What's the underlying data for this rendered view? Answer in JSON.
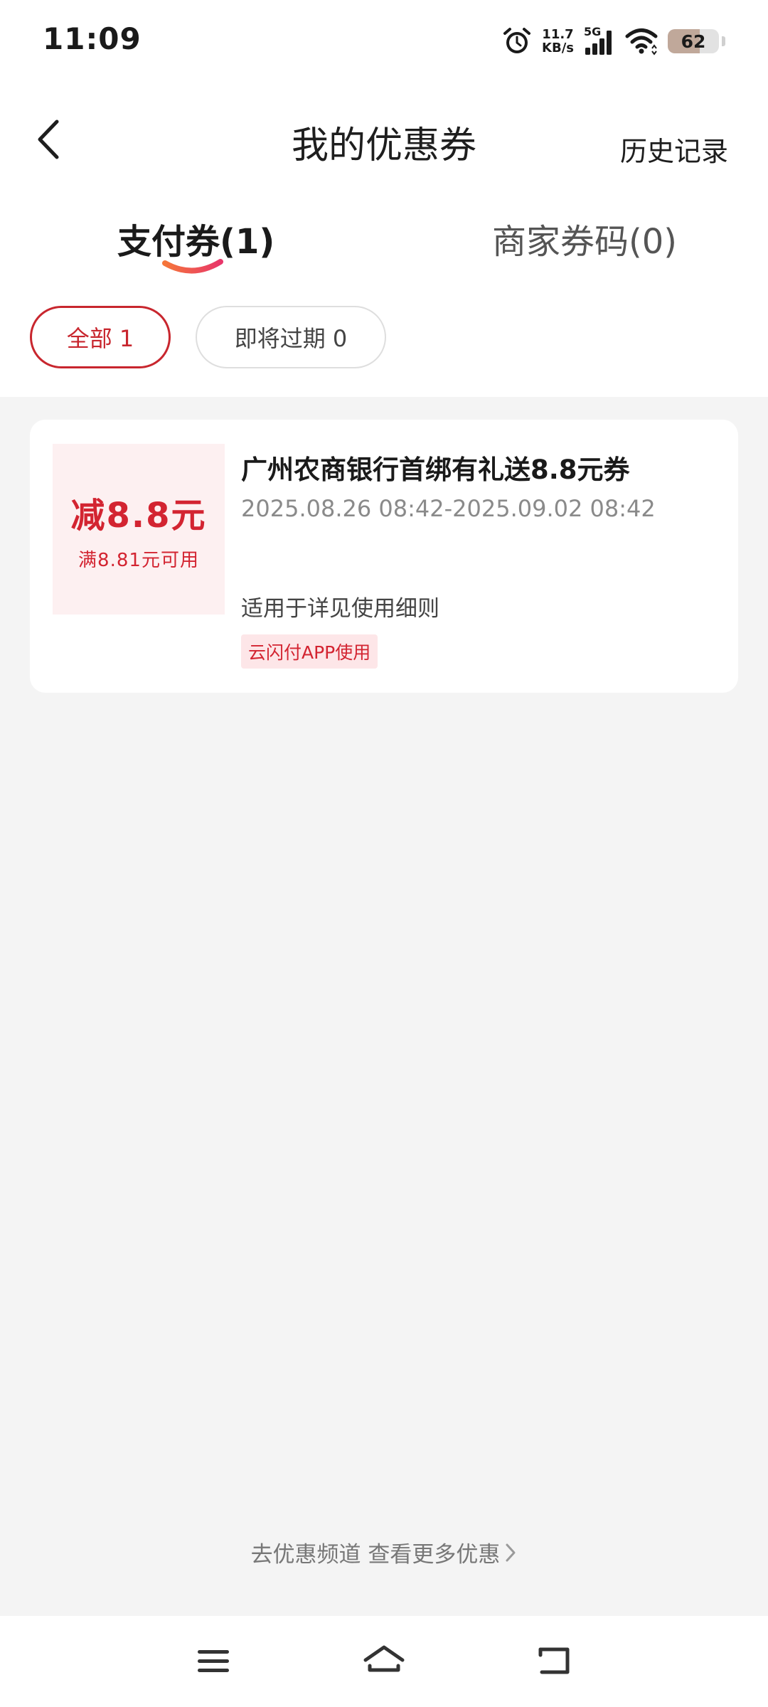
{
  "status_bar": {
    "time": "11:09",
    "net_speed_value": "11.7",
    "net_speed_unit": "KB/s",
    "network_type": "5G",
    "battery_level": "62",
    "battery_fraction": 0.62
  },
  "header": {
    "title": "我的优惠券",
    "history_label": "历史记录",
    "back_icon": "chevron-left-icon"
  },
  "tabs": [
    {
      "label": "支付券(1)",
      "active": true
    },
    {
      "label": "商家券码(0)",
      "active": false
    }
  ],
  "filters": [
    {
      "label": "全部 1",
      "active": true
    },
    {
      "label": "即将过期 0",
      "active": false
    }
  ],
  "coupon": {
    "amount": "减8.8元",
    "condition": "满8.81元可用",
    "title": "广州农商银行首绑有礼送8.8元券",
    "period": "2025.08.26 08:42-2025.09.02 08:42",
    "scope": "适用于详见使用细则",
    "tag": "云闪付APP使用"
  },
  "footer": {
    "more_label": "去优惠频道 查看更多优惠",
    "more_icon": "chevron-right-icon"
  },
  "colors": {
    "accent": "#c8262e",
    "coupon_bg": "#fdf0f1",
    "page_bg": "#f4f4f4"
  }
}
